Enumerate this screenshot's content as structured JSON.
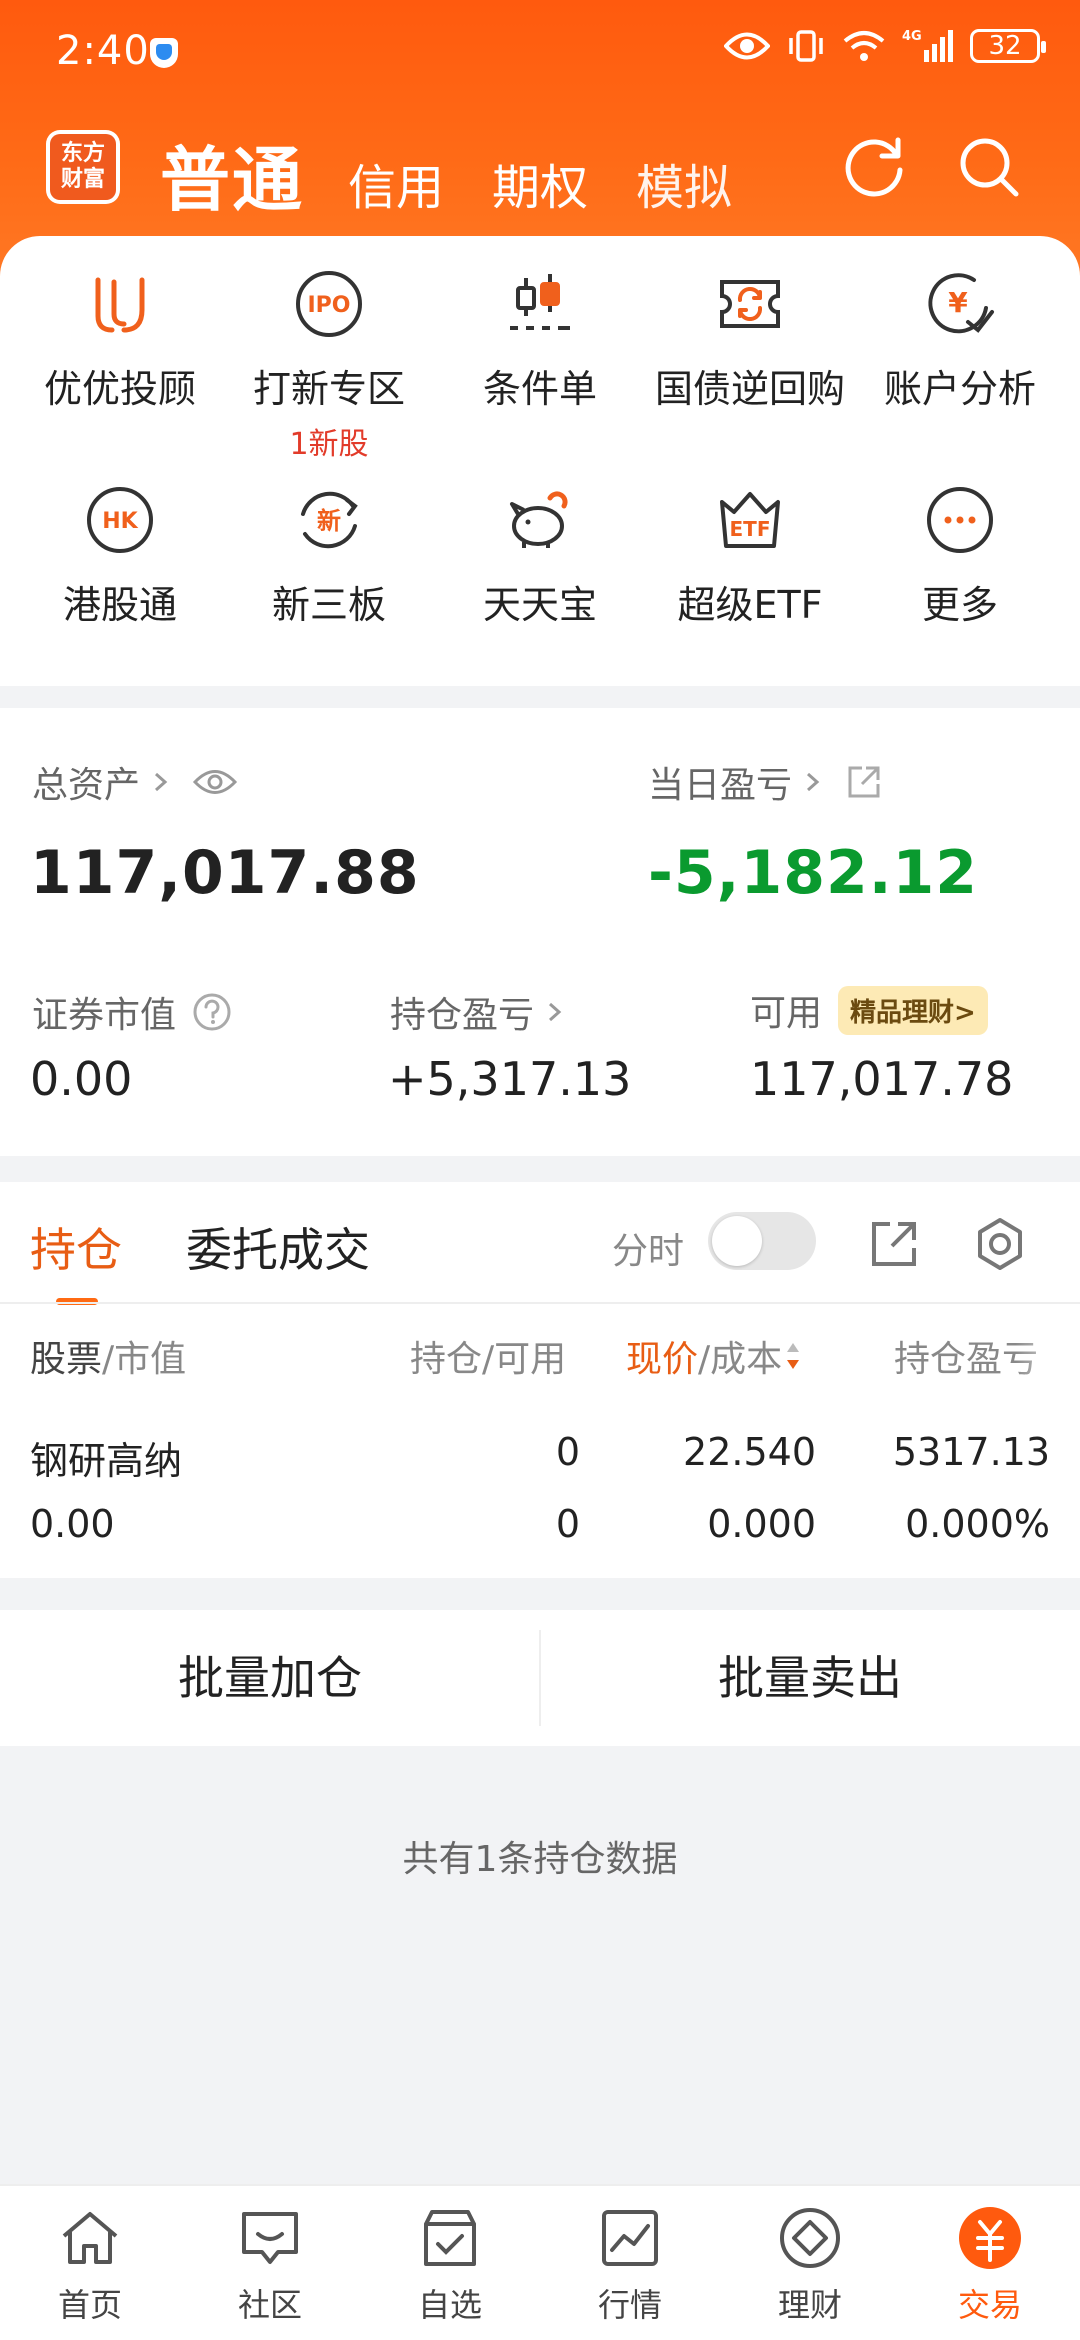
{
  "status": {
    "time": "2:40",
    "battery": "32",
    "network": "4G"
  },
  "header": {
    "logo_line1": "东方",
    "logo_line2": "财富",
    "tabs": [
      "普通",
      "信用",
      "期权",
      "模拟"
    ]
  },
  "menu": [
    {
      "label": "优优投顾",
      "icon": "advisor-icon"
    },
    {
      "label": "打新专区",
      "sub": "1新股",
      "icon": "ipo-icon"
    },
    {
      "label": "条件单",
      "icon": "conditional-order-icon"
    },
    {
      "label": "国债逆回购",
      "icon": "reverse-repo-icon"
    },
    {
      "label": "账户分析",
      "icon": "account-analysis-icon"
    },
    {
      "label": "港股通",
      "icon": "hk-connect-icon"
    },
    {
      "label": "新三板",
      "icon": "neeq-icon"
    },
    {
      "label": "天天宝",
      "icon": "piggy-bank-icon"
    },
    {
      "label": "超级ETF",
      "icon": "etf-icon"
    },
    {
      "label": "更多",
      "icon": "more-icon"
    }
  ],
  "assets": {
    "total_label": "总资产",
    "total_value": "117,017.88",
    "daily_label": "当日盈亏",
    "daily_value": "-5,182.12",
    "market_label": "证券市值",
    "market_value": "0.00",
    "position_pl_label": "持仓盈亏",
    "position_pl_value": "+5,317.13",
    "available_label": "可用",
    "available_badge": "精品理财>",
    "available_value": "117,017.78"
  },
  "holdings": {
    "tab_active": "持仓",
    "tab_other": "委托成交",
    "timeshare_label": "分时",
    "col1_a": "股票",
    "col1_b": "/市值",
    "col2": "持仓/可用",
    "col3_a": "现价",
    "col3_b": "/成本",
    "col4": "持仓盈亏",
    "rows": [
      {
        "name": "钢研高纳",
        "market_value": "0.00",
        "position": "0",
        "available": "0",
        "price": "22.540",
        "cost": "0.000",
        "pl": "5317.13",
        "pl_pct": "0.000%"
      }
    ]
  },
  "actions": {
    "batch_add": "批量加仓",
    "batch_sell": "批量卖出"
  },
  "summary": "共有1条持仓数据",
  "bottom_nav": [
    "首页",
    "社区",
    "自选",
    "行情",
    "理财",
    "交易"
  ],
  "colors": {
    "accent": "#ff5a0e",
    "profit_red": "#e0342b",
    "loss_green": "#0a9a2f"
  }
}
